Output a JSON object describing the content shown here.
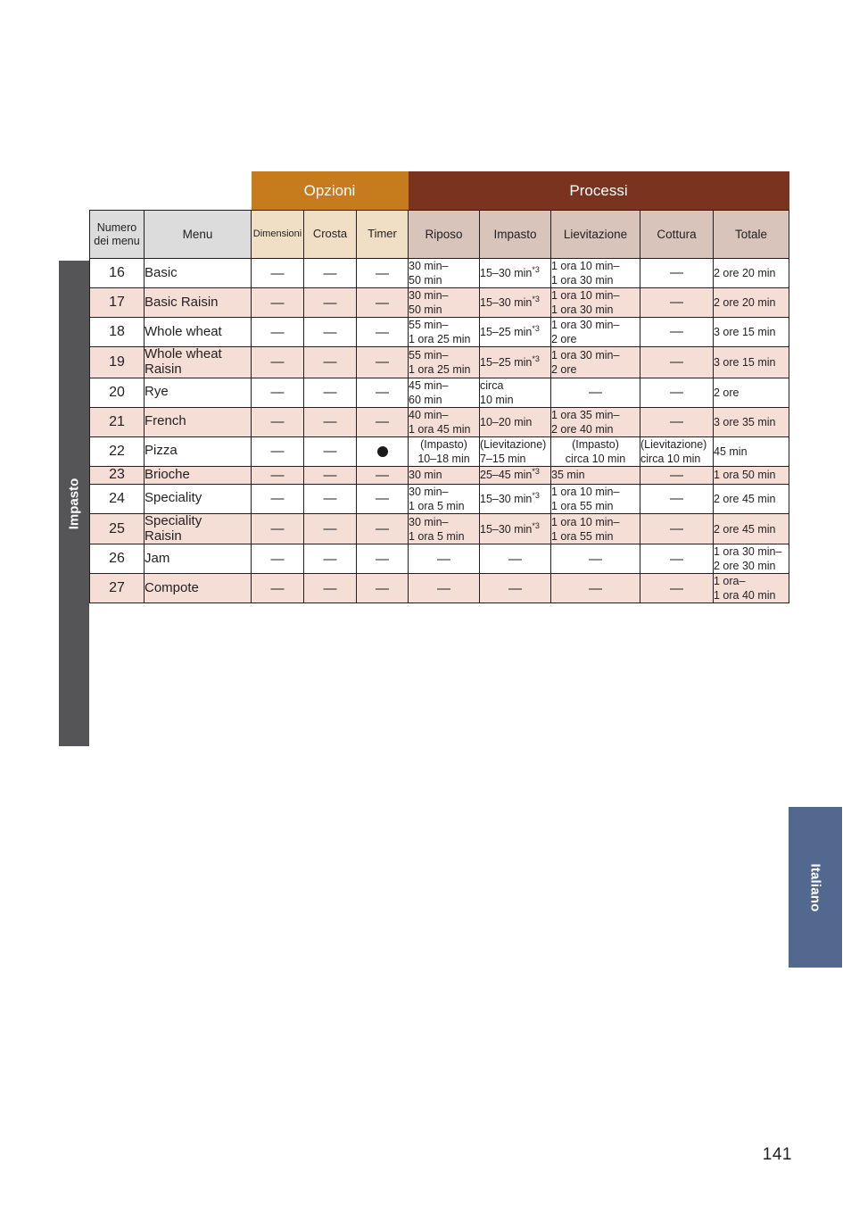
{
  "page": {
    "number": "141",
    "language_tab": "Italiano",
    "section_tab": "Impasto"
  },
  "table": {
    "banners": {
      "options": "Opzioni",
      "processes": "Processi"
    },
    "headers": {
      "menu_number": [
        "Numero",
        "dei menu"
      ],
      "menu": "Menu",
      "options": [
        "Dimensioni",
        "Crosta",
        "Timer"
      ],
      "processes": [
        "Riposo",
        "Impasto",
        "Lievitazione",
        "Cottura",
        "Totale"
      ]
    },
    "dash": "—",
    "rows": [
      {
        "num": "16",
        "menu": [
          "Basic"
        ],
        "shade": "white",
        "dimensioni": "—",
        "crosta": "—",
        "timer": "—",
        "riposo": [
          "30 min–",
          "50 min"
        ],
        "impasto": [
          "15–30 min*3"
        ],
        "lievitazione": [
          "1 ora 10 min–",
          "1 ora 30 min"
        ],
        "cottura": [
          "—"
        ],
        "totale": [
          "2 ore 20 min"
        ]
      },
      {
        "num": "17",
        "menu": [
          "Basic Raisin"
        ],
        "shade": "pink",
        "dimensioni": "—",
        "crosta": "—",
        "timer": "—",
        "riposo": [
          "30 min–",
          "50 min"
        ],
        "impasto": [
          "15–30 min*3"
        ],
        "lievitazione": [
          "1 ora 10 min–",
          "1 ora 30 min"
        ],
        "cottura": [
          "—"
        ],
        "totale": [
          "2 ore 20 min"
        ]
      },
      {
        "num": "18",
        "menu": [
          "Whole wheat"
        ],
        "shade": "white",
        "dimensioni": "—",
        "crosta": "—",
        "timer": "—",
        "riposo": [
          "55 min–",
          "1 ora 25 min"
        ],
        "impasto": [
          "15–25 min*3"
        ],
        "lievitazione": [
          "1 ora 30 min–",
          "2 ore"
        ],
        "cottura": [
          "—"
        ],
        "totale": [
          "3 ore 15 min"
        ]
      },
      {
        "num": "19",
        "menu": [
          "Whole wheat",
          "Raisin"
        ],
        "shade": "pink",
        "dimensioni": "—",
        "crosta": "—",
        "timer": "—",
        "riposo": [
          "55 min–",
          "1 ora 25 min"
        ],
        "impasto": [
          "15–25 min*3"
        ],
        "lievitazione": [
          "1 ora 30 min–",
          "2 ore"
        ],
        "cottura": [
          "—"
        ],
        "totale": [
          "3 ore 15 min"
        ]
      },
      {
        "num": "20",
        "menu": [
          "Rye"
        ],
        "shade": "white",
        "dimensioni": "—",
        "crosta": "—",
        "timer": "—",
        "riposo": [
          "45 min–",
          "60 min"
        ],
        "impasto": [
          "circa",
          "10 min"
        ],
        "lievitazione": [
          "—"
        ],
        "cottura": [
          "—"
        ],
        "totale": [
          "2 ore"
        ]
      },
      {
        "num": "21",
        "menu": [
          "French"
        ],
        "shade": "pink",
        "dimensioni": "—",
        "crosta": "—",
        "timer": "—",
        "riposo": [
          "40 min–",
          "1 ora 45 min"
        ],
        "impasto": [
          "10–20 min"
        ],
        "lievitazione": [
          "1 ora 35 min–",
          "2 ore 40 min"
        ],
        "cottura": [
          "—"
        ],
        "totale": [
          "3 ore 35 min"
        ]
      },
      {
        "num": "22",
        "menu": [
          "Pizza"
        ],
        "shade": "white",
        "dimensioni": "—",
        "crosta": "—",
        "timer": "dot",
        "riposo": [
          "(Impasto)",
          "10–18 min"
        ],
        "impasto": [
          "(Lievitazione)",
          "7–15 min"
        ],
        "lievitazione": [
          "(Impasto)",
          "circa 10 min"
        ],
        "cottura": [
          "(Lievitazione)",
          "circa 10 min"
        ],
        "totale": [
          "45 min"
        ]
      },
      {
        "num": "23",
        "menu": [
          "Brioche"
        ],
        "shade": "pink",
        "dimensioni": "—",
        "crosta": "—",
        "timer": "—",
        "riposo": [
          "30 min"
        ],
        "impasto": [
          "25–45 min*3"
        ],
        "lievitazione": [
          "35 min"
        ],
        "cottura": [
          "—"
        ],
        "totale": [
          "1 ora 50 min"
        ]
      },
      {
        "num": "24",
        "menu": [
          "Speciality"
        ],
        "shade": "white",
        "dimensioni": "—",
        "crosta": "—",
        "timer": "—",
        "riposo": [
          "30 min–",
          "1 ora 5 min"
        ],
        "impasto": [
          "15–30 min*3"
        ],
        "lievitazione": [
          "1 ora 10 min–",
          "1 ora 55 min"
        ],
        "cottura": [
          "—"
        ],
        "totale": [
          "2 ore 45 min"
        ]
      },
      {
        "num": "25",
        "menu": [
          "Speciality",
          "Raisin"
        ],
        "shade": "pink",
        "dimensioni": "—",
        "crosta": "—",
        "timer": "—",
        "riposo": [
          "30 min–",
          "1 ora 5 min"
        ],
        "impasto": [
          "15–30 min*3"
        ],
        "lievitazione": [
          "1 ora 10 min–",
          "1 ora 55 min"
        ],
        "cottura": [
          "—"
        ],
        "totale": [
          "2 ore 45 min"
        ]
      },
      {
        "num": "26",
        "menu": [
          "Jam"
        ],
        "shade": "white",
        "dimensioni": "—",
        "crosta": "—",
        "timer": "—",
        "riposo": [
          "—"
        ],
        "impasto": [
          "—"
        ],
        "lievitazione": [
          "—"
        ],
        "cottura": [
          "—"
        ],
        "totale": [
          "1 ora 30 min–",
          "2 ore 30 min"
        ]
      },
      {
        "num": "27",
        "menu": [
          "Compote"
        ],
        "shade": "pink",
        "dimensioni": "—",
        "crosta": "—",
        "timer": "—",
        "riposo": [
          "—"
        ],
        "impasto": [
          "—"
        ],
        "lievitazione": [
          "—"
        ],
        "cottura": [
          "—"
        ],
        "totale": [
          "1 ora–",
          "1 ora 40 min"
        ]
      }
    ]
  },
  "colors": {
    "banner_options": "#c67c1c",
    "banner_processes": "#7a331f",
    "header_gray": "#dcdcdc",
    "header_tan": "#f0dfc4",
    "header_taupe": "#d9c4bb",
    "row_pink": "#f4ded6",
    "section_tab": "#555456",
    "language_tab": "#53688f"
  }
}
